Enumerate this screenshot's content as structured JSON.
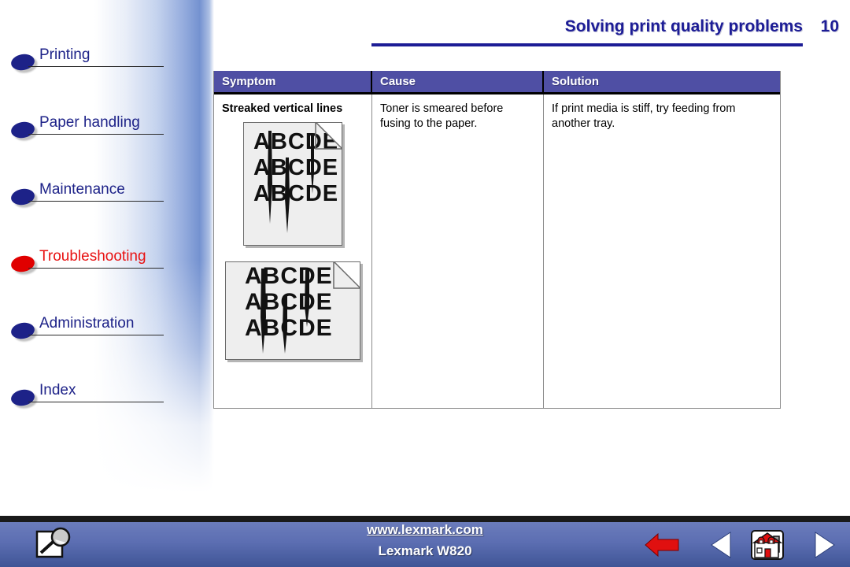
{
  "header": {
    "title": "Solving print quality problems",
    "page_number": "10",
    "title_color": "#1d1d96"
  },
  "sidebar": {
    "items": [
      {
        "label": "Printing",
        "state": "normal",
        "bullet_color": "#1d2288",
        "text_color": "#1d2288"
      },
      {
        "label": "Paper handling",
        "state": "normal",
        "bullet_color": "#1d2288",
        "text_color": "#1d2288"
      },
      {
        "label": "Maintenance",
        "state": "normal",
        "bullet_color": "#1d2288",
        "text_color": "#1d2288"
      },
      {
        "label": "Troubleshooting",
        "state": "active",
        "bullet_color": "#e00000",
        "text_color": "#e81212"
      },
      {
        "label": "Administration",
        "state": "normal",
        "bullet_color": "#1d2288",
        "text_color": "#1d2288"
      },
      {
        "label": "Index",
        "state": "normal",
        "bullet_color": "#1d2288",
        "text_color": "#1d2288"
      }
    ]
  },
  "table": {
    "header_bg": "#4f4fa4",
    "columns": [
      "Symptom",
      "Cause",
      "Solution"
    ],
    "rows": [
      {
        "symptom": "Streaked vertical lines",
        "cause": "Toner is smeared before fusing to the paper.",
        "solution": "If print media is stiff, try feeding from another tray."
      }
    ],
    "illustrations": {
      "portrait": {
        "text_lines": [
          "ABCDE",
          "ABCDE",
          "ABCDE"
        ],
        "orientation": "portrait"
      },
      "landscape": {
        "text_lines": [
          "ABCDE",
          "ABCDE",
          "ABCDE"
        ],
        "orientation": "landscape"
      }
    }
  },
  "footer": {
    "url": "www.lexmark.com",
    "model": "Lexmark W820",
    "search_icon": "magnifier-icon",
    "buttons": [
      {
        "name": "back-button",
        "icon": "red-left-arrow-icon"
      },
      {
        "name": "previous-page-button",
        "icon": "left-triangle-icon"
      },
      {
        "name": "home-button",
        "icon": "house-icon"
      },
      {
        "name": "next-page-button",
        "icon": "right-triangle-icon"
      }
    ]
  }
}
